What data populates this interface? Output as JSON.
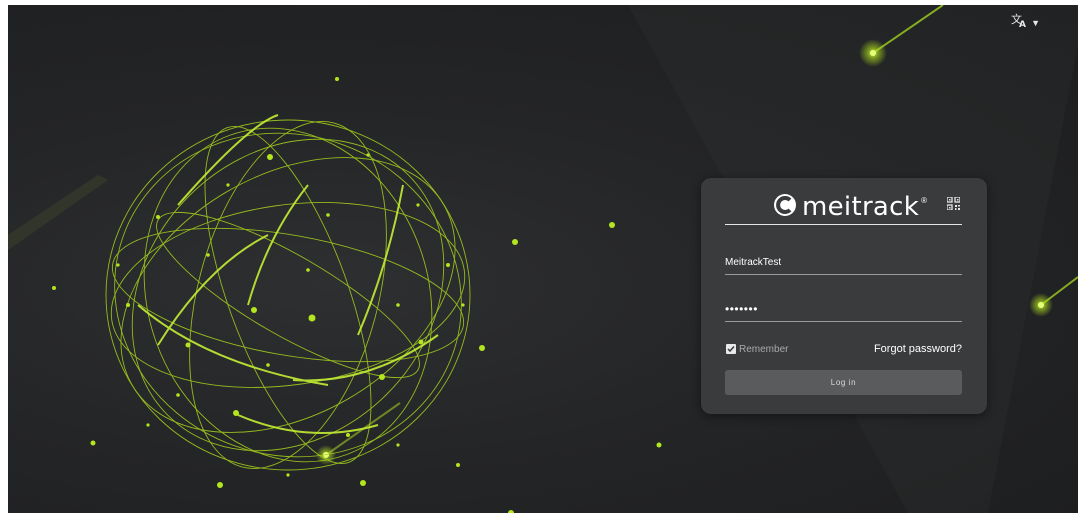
{
  "header": {
    "language_icon": "translate-icon",
    "language_menu_icon": "caret-down-icon"
  },
  "login": {
    "logo": {
      "brand": "meitrack",
      "registered_mark": "®",
      "icon": "meitrack-logo-icon"
    },
    "qr_icon": "qr-code-icon",
    "username": {
      "value": "MeitrackTest"
    },
    "password": {
      "value": "•••••••"
    },
    "remember_label": "Remember",
    "remember_checked": true,
    "forgot_label": "Forgot password?",
    "login_label": "Log in"
  },
  "colors": {
    "accent_green": "#b4e61e",
    "card_bg": "#3a3b3d",
    "button_bg": "#5a5b5d"
  }
}
